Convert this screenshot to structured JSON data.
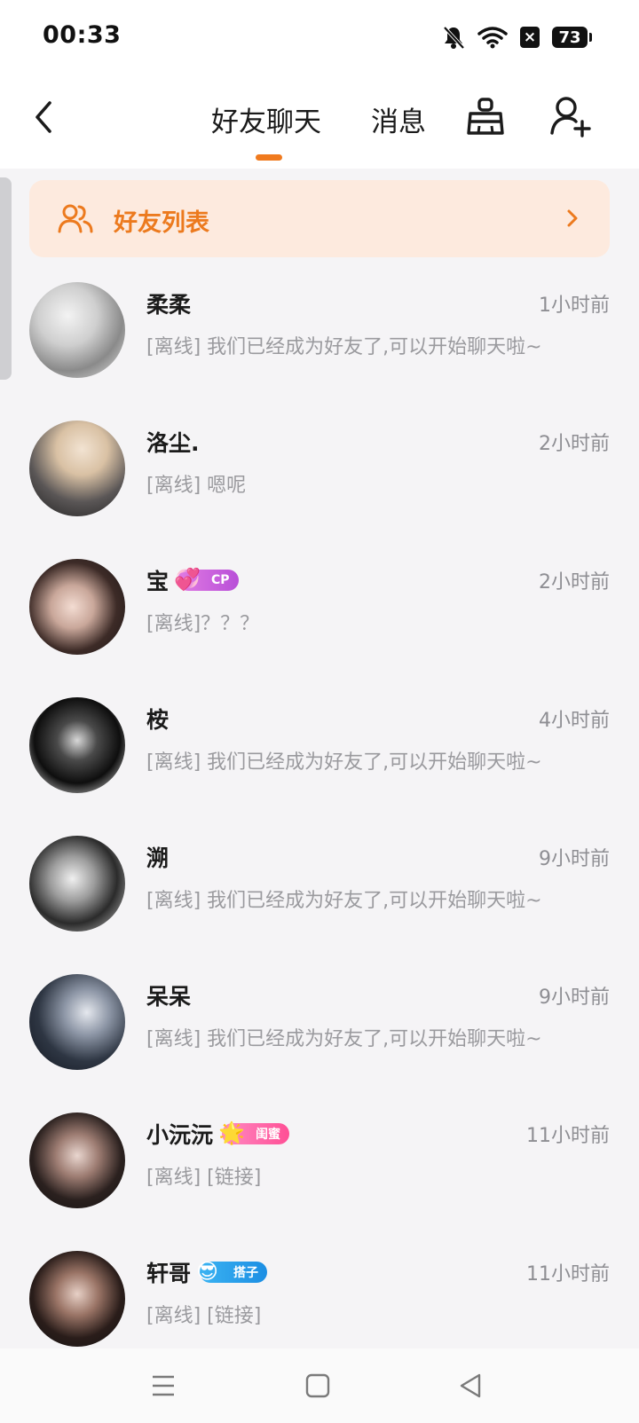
{
  "status_bar": {
    "time": "00:33",
    "battery": "73",
    "icons": [
      "bell-off-icon",
      "wifi-icon",
      "x-badge-icon",
      "battery-icon"
    ]
  },
  "header": {
    "tabs": [
      {
        "label": "好友聊天",
        "active": true
      },
      {
        "label": "消息",
        "active": false
      }
    ],
    "icons": [
      "back-icon",
      "clean-broom-icon",
      "add-friend-icon"
    ],
    "accent_color": "#f07a1e"
  },
  "friends_banner": {
    "label": "好友列表",
    "icon": "users-icon",
    "color": "#ec7a1e"
  },
  "chats": [
    {
      "name": "柔柔",
      "time": "1小时前",
      "preview": "[离线] 我们已经成为好友了,可以开始聊天啦~",
      "badge": null
    },
    {
      "name": "洛尘.",
      "time": "2小时前",
      "preview": "[离线] 嗯呢",
      "badge": null
    },
    {
      "name": "宝",
      "time": "2小时前",
      "preview": "[离线]？？？",
      "badge": "CP"
    },
    {
      "name": "桉",
      "time": "4小时前",
      "preview": "[离线] 我们已经成为好友了,可以开始聊天啦~",
      "badge": null
    },
    {
      "name": "溯",
      "time": "9小时前",
      "preview": "[离线] 我们已经成为好友了,可以开始聊天啦~",
      "badge": null
    },
    {
      "name": "呆呆",
      "time": "9小时前",
      "preview": "[离线] 我们已经成为好友了,可以开始聊天啦~",
      "badge": null
    },
    {
      "name": "小沅沅",
      "time": "11小时前",
      "preview": "[离线] [链接]",
      "badge": "闺蜜"
    },
    {
      "name": "轩哥",
      "time": "11小时前",
      "preview": "[离线] [链接]",
      "badge": "搭子"
    }
  ],
  "nav_bar": {
    "icons": [
      "menu-icon",
      "home-square-icon",
      "back-triangle-icon"
    ]
  }
}
